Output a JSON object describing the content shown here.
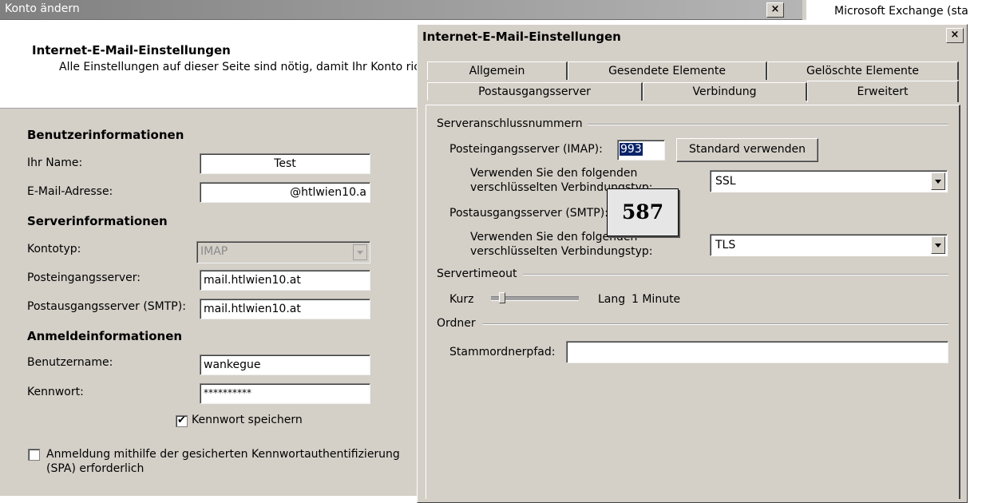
{
  "background_window": {
    "title": "Konto ändern",
    "close_glyph": "×",
    "header": {
      "title": "Internet-E-Mail-Einstellungen",
      "subtitle": "Alle Einstellungen auf dieser Seite sind nötig, damit Ihr Konto rich"
    },
    "user_info": {
      "heading": "Benutzerinformationen",
      "name_label": "Ihr Name:",
      "name_value": "Test",
      "email_label": "E-Mail-Adresse:",
      "email_value": "@htlwien10.a"
    },
    "server_info": {
      "heading": "Serverinformationen",
      "account_type_label": "Kontotyp:",
      "account_type_value": "IMAP",
      "incoming_label": "Posteingangsserver:",
      "incoming_value": "mail.htlwien10.at",
      "outgoing_label": "Postausgangsserver (SMTP):",
      "outgoing_value": "mail.htlwien10.at"
    },
    "login_info": {
      "heading": "Anmeldeinformationen",
      "username_label": "Benutzername:",
      "username_value": "wankegue",
      "password_label": "Kennwort:",
      "password_value": "**********",
      "save_password_label": "Kennwort speichern",
      "save_password_checked": true,
      "spa_label_line1": "Anmeldung mithilfe der gesicherten Kennwortauthentifizierung",
      "spa_label_line2": "(SPA) erforderlich",
      "spa_checked": false
    }
  },
  "exchange_stub": {
    "text": "Microsoft Exchange (sta"
  },
  "dialog": {
    "title": "Internet-E-Mail-Einstellungen",
    "close_glyph": "×",
    "tabs_row1": [
      "Allgemein",
      "Gesendete Elemente",
      "Gelöschte Elemente"
    ],
    "tabs_row2": [
      "Postausgangsserver",
      "Verbindung",
      "Erweitert"
    ],
    "active_tab": "Erweitert",
    "server_ports": {
      "group_label": "Serveranschlussnummern",
      "incoming_label": "Posteingangsserver (IMAP):",
      "incoming_port": "993",
      "default_button": "Standard verwenden",
      "incoming_enc_label_line1": "Verwenden Sie den folgenden",
      "incoming_enc_label_line2": "verschlüsselten Verbindungstyp:",
      "incoming_enc_value": "SSL",
      "outgoing_label": "Postausgangsserver (SMTP):",
      "outgoing_port": "587",
      "outgoing_enc_label_line1": "Verwenden Sie den folgenden",
      "outgoing_enc_label_line2": "verschlüsselten Verbindungstyp:",
      "outgoing_enc_value": "TLS"
    },
    "timeout": {
      "group_label": "Servertimeout",
      "short_label": "Kurz",
      "long_label": "Lang",
      "value_text": "1 Minute",
      "slider_level": 0.1
    },
    "folders": {
      "group_label": "Ordner",
      "root_path_label": "Stammordnerpfad:",
      "root_path_value": ""
    }
  }
}
